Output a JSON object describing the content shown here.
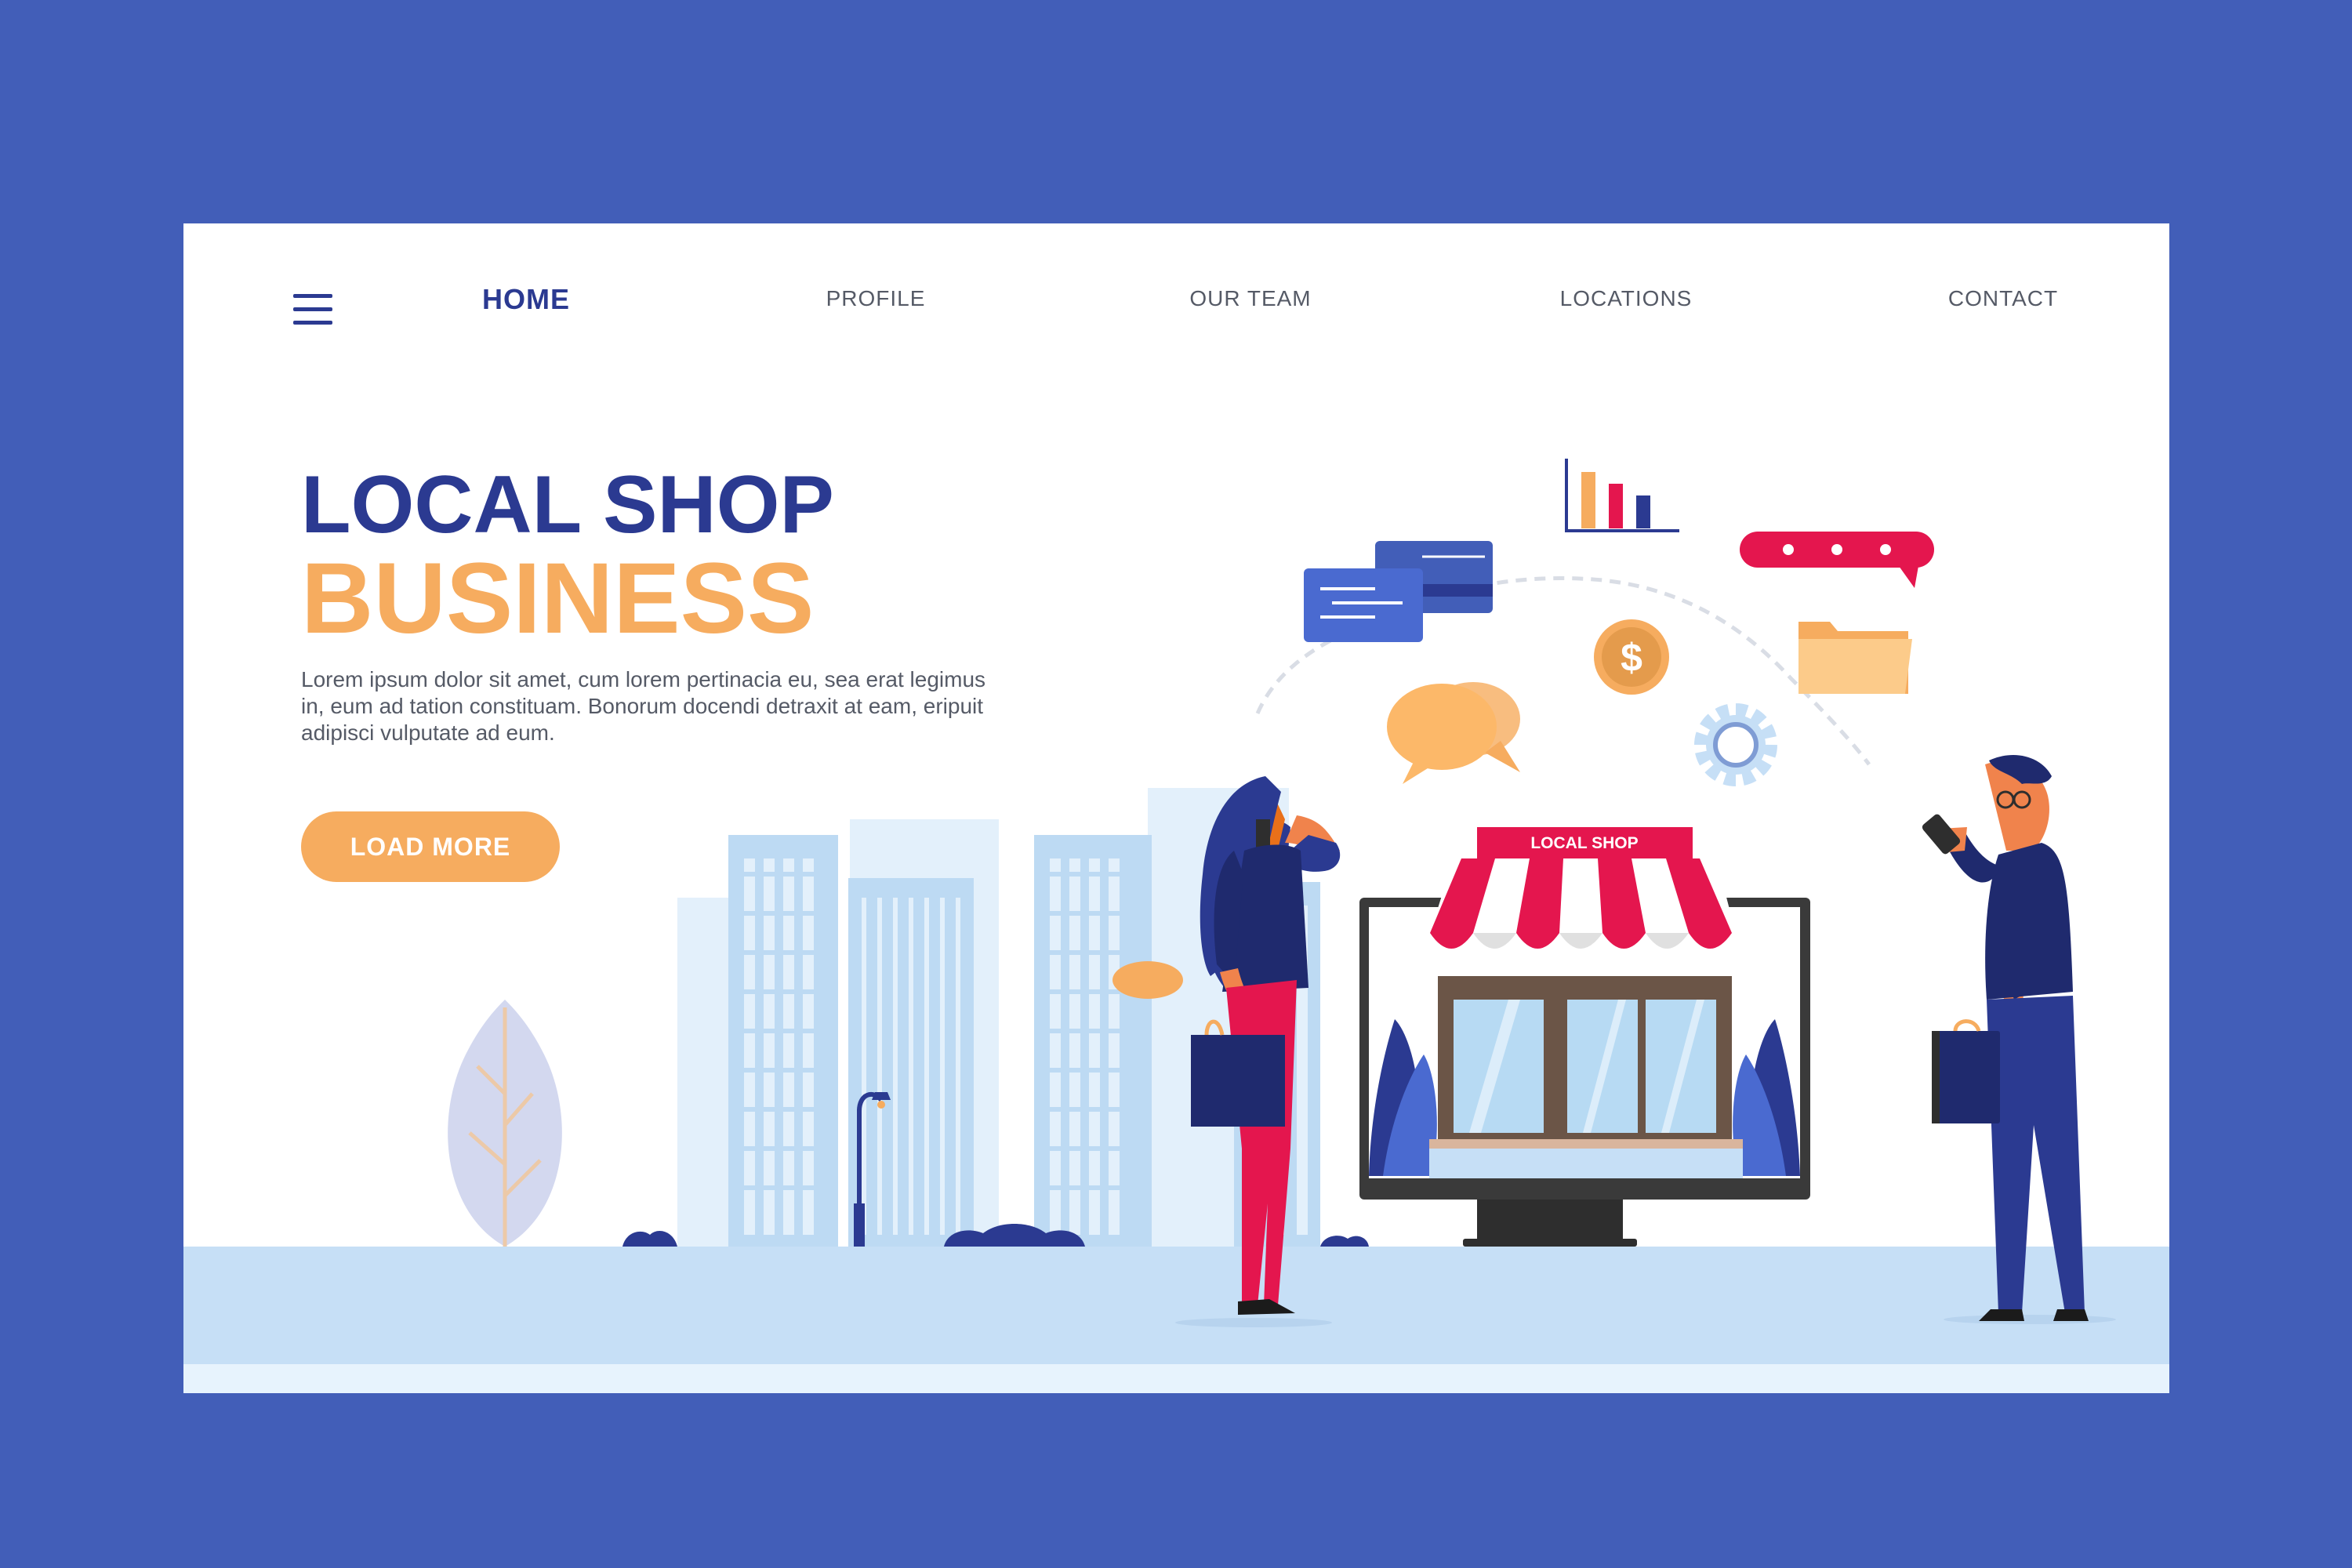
{
  "nav": {
    "menu_icon": "hamburger-menu-icon",
    "items": [
      {
        "label": "HOME",
        "active": true
      },
      {
        "label": "PROFILE",
        "active": false
      },
      {
        "label": "OUR TEAM",
        "active": false
      },
      {
        "label": "LOCATIONS",
        "active": false
      },
      {
        "label": "CONTACT",
        "active": false
      }
    ]
  },
  "hero": {
    "title_line1": "LOCAL SHOP",
    "title_line2": "BUSINESS",
    "body": "Lorem ipsum dolor sit amet, cum lorem pertinacia eu, sea erat legimus in, eum ad tation constituam. Bonorum docendi detraxit at eam, eripuit adipisci vulputate ad eum.",
    "button_label": "LOAD MORE"
  },
  "illustration": {
    "shop_sign": "LOCAL SHOP",
    "icons": [
      "credit-card-icon",
      "bar-chart-icon",
      "chat-bubble-icon",
      "speech-bubbles-icon",
      "dollar-coin-icon",
      "gear-icon",
      "folder-icon"
    ]
  },
  "colors": {
    "background": "#425eb8",
    "primary": "#2b3a91",
    "accent": "#f6ac5f",
    "awning_red": "#e4164e"
  }
}
